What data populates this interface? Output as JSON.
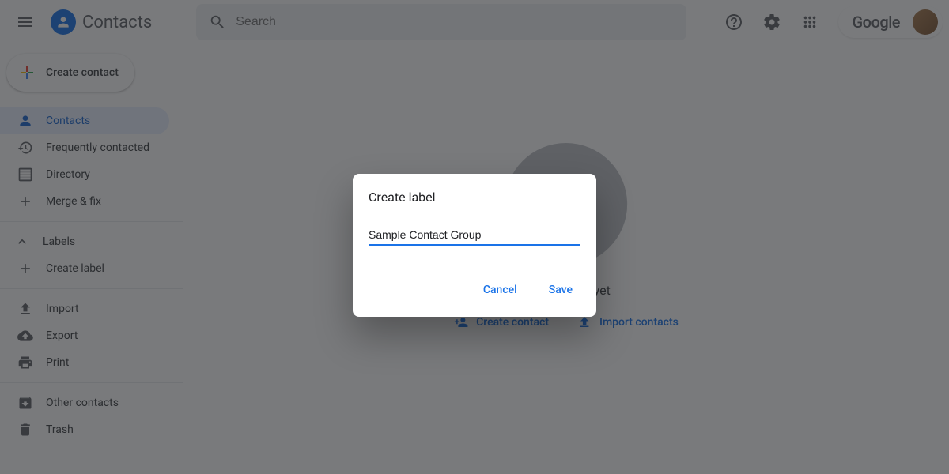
{
  "header": {
    "app_title": "Contacts",
    "search_placeholder": "Search",
    "google_text": "Google"
  },
  "sidebar": {
    "create_contact_label": "Create contact",
    "items": [
      {
        "label": "Contacts"
      },
      {
        "label": "Frequently contacted"
      },
      {
        "label": "Directory"
      },
      {
        "label": "Merge & fix"
      }
    ],
    "labels_header": "Labels",
    "create_label": "Create label",
    "import_label": "Import",
    "export_label": "Export",
    "print_label": "Print",
    "other_contacts_label": "Other contacts",
    "trash_label": "Trash"
  },
  "main": {
    "empty_text": "No contacts yet",
    "create_contact_action": "Create contact",
    "import_contacts_action": "Import contacts"
  },
  "dialog": {
    "title": "Create label",
    "input_value": "Sample Contact Group ",
    "cancel_label": "Cancel",
    "save_label": "Save"
  }
}
